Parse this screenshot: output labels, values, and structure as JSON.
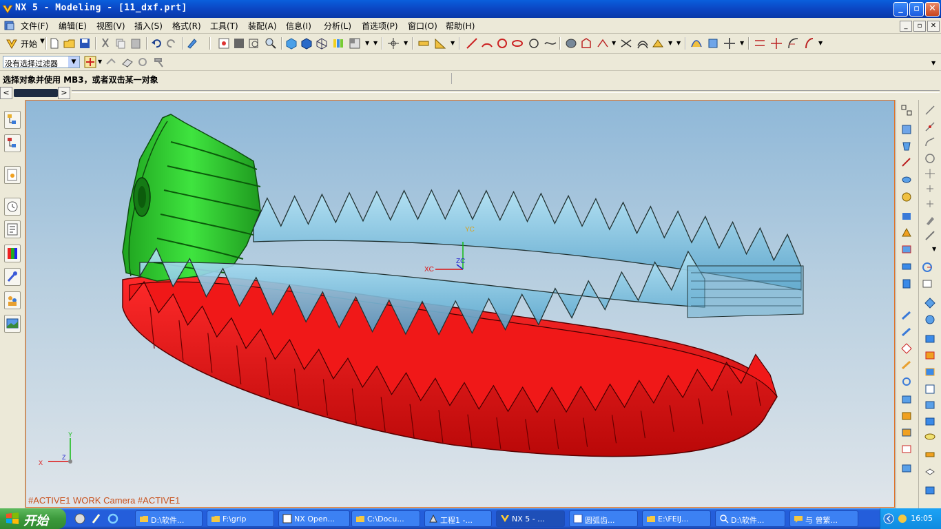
{
  "window": {
    "title": "NX 5 - Modeling - [11_dxf.prt]"
  },
  "menu": {
    "items": [
      "文件(F)",
      "编辑(E)",
      "视图(V)",
      "插入(S)",
      "格式(R)",
      "工具(T)",
      "装配(A)",
      "信息(I)",
      "分析(L)",
      "首选项(P)",
      "窗口(O)",
      "帮助(H)"
    ]
  },
  "toolbar": {
    "start_label": "开始",
    "filter_value": "没有选择过滤器"
  },
  "prompt": {
    "text": "选择对象并使用 MB3，或者双击某一对象"
  },
  "viewport": {
    "status": "#ACTIVE1 WORK Camera #ACTIVE1",
    "wcs": {
      "x": "XC",
      "y": "YC",
      "z": "ZC"
    },
    "triad": {
      "x": "X",
      "y": "Y",
      "z": "Z"
    },
    "colors": {
      "green_gear": "#2fd12f",
      "red_gear": "#e10d0d",
      "blue_gear": "#7fc3e0"
    }
  },
  "taskbar": {
    "start_label": "开始",
    "tasks": [
      {
        "label": "D:\\软件..."
      },
      {
        "label": "F:\\grip"
      },
      {
        "label": "NX Open..."
      },
      {
        "label": "C:\\Docu..."
      },
      {
        "label": "工程1 -..."
      },
      {
        "label": "NX 5 - ..."
      },
      {
        "label": "圆弧齿..."
      },
      {
        "label": "E:\\FEIJ..."
      },
      {
        "label": "D:\\软件..."
      },
      {
        "label": "与 曾繁..."
      }
    ],
    "clock": "16:05"
  }
}
